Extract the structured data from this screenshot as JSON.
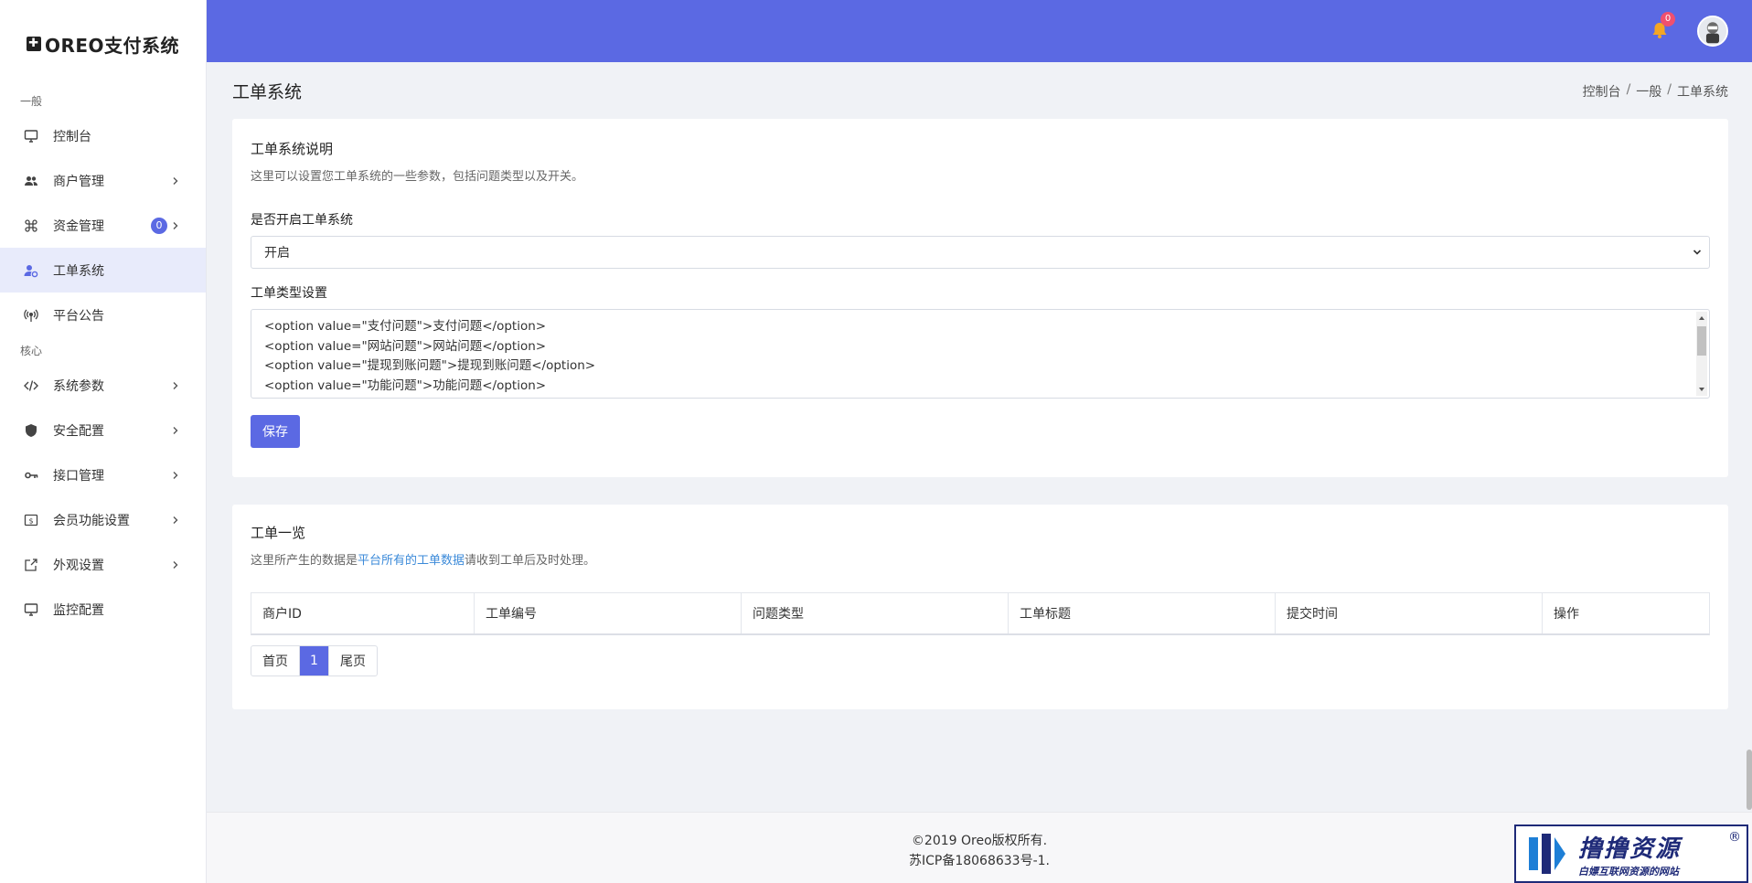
{
  "brand": {
    "icon": "✚",
    "name": "OREO支付系统"
  },
  "sidebar": {
    "sections": [
      {
        "label": "一般"
      },
      {
        "label": "核心"
      }
    ],
    "items": [
      {
        "label": "控制台",
        "icon": "monitor-icon"
      },
      {
        "label": "商户管理",
        "icon": "users-icon"
      },
      {
        "label": "资金管理",
        "icon": "command-icon",
        "badge": "0"
      },
      {
        "label": "工单系统",
        "icon": "user-gear-icon"
      },
      {
        "label": "平台公告",
        "icon": "broadcast-icon"
      },
      {
        "label": "系统参数",
        "icon": "code-icon"
      },
      {
        "label": "安全配置",
        "icon": "shield-icon"
      },
      {
        "label": "接口管理",
        "icon": "key-icon"
      },
      {
        "label": "会员功能设置",
        "icon": "dollar-box-icon"
      },
      {
        "label": "外观设置",
        "icon": "external-box-icon"
      },
      {
        "label": "监控配置",
        "icon": "monitor-icon"
      }
    ]
  },
  "header": {
    "notification_count": "0",
    "accent": "#5b69e3"
  },
  "page": {
    "title": "工单系统",
    "breadcrumb": [
      "控制台",
      "一般",
      "工单系统"
    ]
  },
  "settings_card": {
    "title": "工单系统说明",
    "description": "这里可以设置您工单系统的一些参数，包括问题类型以及开关。",
    "enable_label": "是否开启工单系统",
    "enable_value": "开启",
    "types_label": "工单类型设置",
    "types_lines": [
      "<option value=\"支付问题\">支付问题</option>",
      "<option value=\"网站问题\">网站问题</option>",
      "<option value=\"提现到账问题\">提现到账问题</option>",
      "<option value=\"功能问题\">功能问题</option>"
    ],
    "save_label": "保存"
  },
  "list_card": {
    "title": "工单一览",
    "desc_prefix": "这里所产生的数据是",
    "desc_highlight": "平台所有的工单数据",
    "desc_suffix": "请收到工单后及时处理。",
    "columns": [
      "商户ID",
      "工单编号",
      "问题类型",
      "工单标题",
      "提交时间",
      "操作"
    ],
    "pagination": {
      "first": "首页",
      "current": "1",
      "last": "尾页"
    }
  },
  "footer": {
    "copyright": "©2019 Oreo版权所有.",
    "icp": "苏ICP备18068633号-1."
  },
  "watermark": {
    "title": "撸撸资源",
    "subtitle": "白嫖互联网资源的网站",
    "reg": "®"
  }
}
